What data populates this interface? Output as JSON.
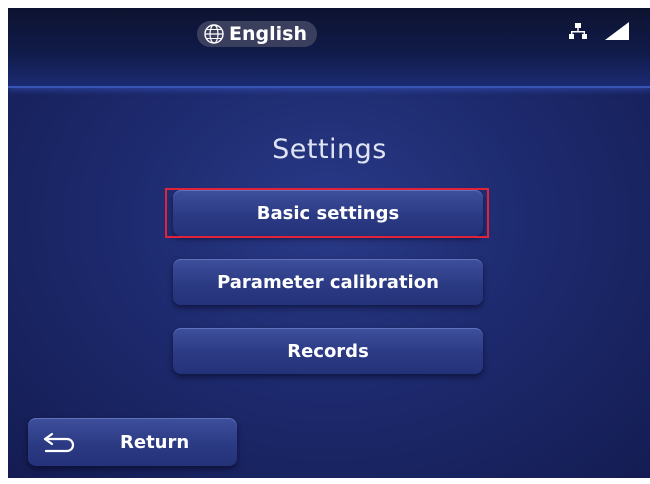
{
  "header": {
    "language": "English",
    "language_icon": "globe-icon",
    "network_icon": "network-icon",
    "signal_icon": "signal-icon"
  },
  "page": {
    "title": "Settings"
  },
  "menu": {
    "items": [
      {
        "label": "Basic settings",
        "selected": true
      },
      {
        "label": "Parameter calibration",
        "selected": false
      },
      {
        "label": "Records",
        "selected": false
      }
    ]
  },
  "footer": {
    "return_label": "Return",
    "return_icon": "return-arrow-icon"
  },
  "colors": {
    "background": "#1d2a6e",
    "button": "#2b3a83",
    "highlight": "#e0233a",
    "text": "#ffffff"
  }
}
